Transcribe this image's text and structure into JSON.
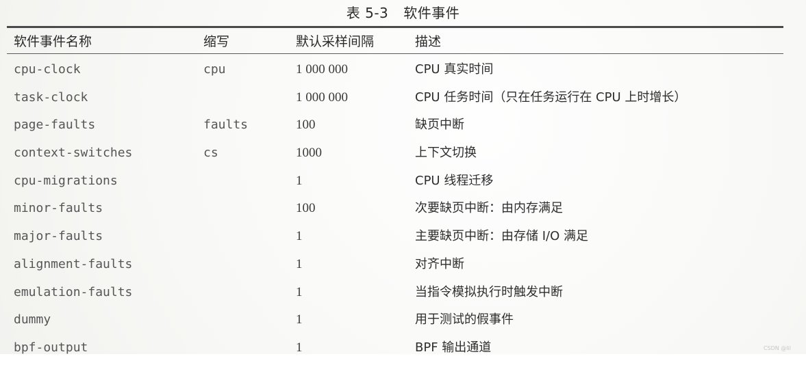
{
  "caption": {
    "number": "表 5-3",
    "title": "软件事件"
  },
  "table": {
    "headers": [
      "软件事件名称",
      "缩写",
      "默认采样间隔",
      "描述"
    ],
    "rows": [
      {
        "name": "cpu-clock",
        "abbr": "cpu",
        "interval": "1 000 000",
        "desc": "CPU 真实时间"
      },
      {
        "name": "task-clock",
        "abbr": "",
        "interval": "1 000 000",
        "desc": "CPU 任务时间（只在任务运行在 CPU 上时增长）"
      },
      {
        "name": "page-faults",
        "abbr": "faults",
        "interval": "100",
        "desc": "缺页中断"
      },
      {
        "name": "context-switches",
        "abbr": "cs",
        "interval": "1000",
        "desc": "上下文切换"
      },
      {
        "name": "cpu-migrations",
        "abbr": "",
        "interval": "1",
        "desc": "CPU 线程迁移"
      },
      {
        "name": "minor-faults",
        "abbr": "",
        "interval": "100",
        "desc": "次要缺页中断：由内存满足"
      },
      {
        "name": "major-faults",
        "abbr": "",
        "interval": "1",
        "desc": "主要缺页中断：由存储 I/O 满足"
      },
      {
        "name": "alignment-faults",
        "abbr": "",
        "interval": "1",
        "desc": "对齐中断"
      },
      {
        "name": "emulation-faults",
        "abbr": "",
        "interval": "1",
        "desc": "当指令模拟执行时触发中断"
      },
      {
        "name": "dummy",
        "abbr": "",
        "interval": "1",
        "desc": "用于测试的假事件"
      },
      {
        "name": "bpf-output",
        "abbr": "",
        "interval": "1",
        "desc": "BPF 输出通道"
      }
    ]
  },
  "watermark": "CSDN @lil"
}
